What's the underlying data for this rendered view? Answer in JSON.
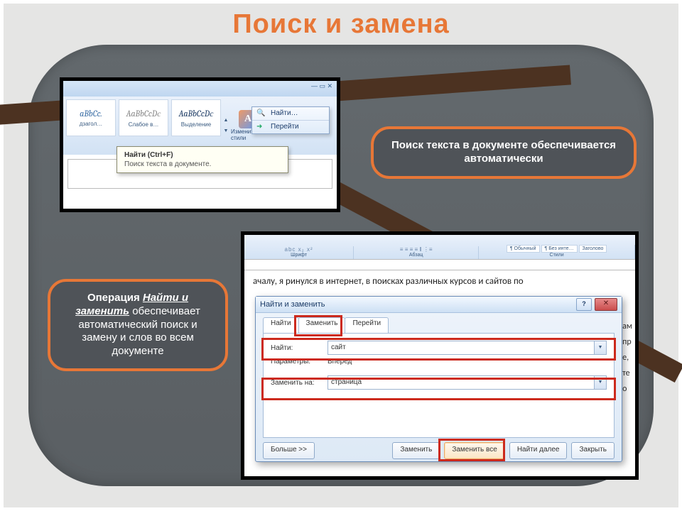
{
  "title": "Поиск и замена",
  "shot1": {
    "win_controls": "— ▭ ✕",
    "styles": [
      {
        "samp": "aBbCc.",
        "cap": "дзагол…"
      },
      {
        "samp": "AaBbCcDс",
        "cap": "Слабое в…"
      },
      {
        "samp": "AaBbCcDс",
        "cap": "Выделение"
      }
    ],
    "changeStyles": "Изменить стили",
    "menu": {
      "find": "Найти…",
      "goto": "Перейти"
    },
    "tooltip": {
      "title": "Найти (Ctrl+F)",
      "body": "Поиск текста в документе."
    }
  },
  "shot2": {
    "groups": {
      "font": "Шрифт",
      "para": "Абзац",
      "styles": "Стили"
    },
    "styleNames": {
      "s1": "¶ Обычный",
      "s2": "¶ Без инте…",
      "s3": "Заголово"
    },
    "fontbits": "abc x₂ x²",
    "bodytext": "ачалу, я ринулся в интернет, в поисках различных курсов и сайтов по",
    "sidetext": {
      "a": "ам",
      "b": "пр",
      "c": "е,",
      "d": "те",
      "e": "о"
    },
    "dlg": {
      "title": "Найти и заменить",
      "tabs": {
        "find": "Найти",
        "replace": "Заменить",
        "goto": "Перейти"
      },
      "findLabel": "Найти:",
      "findValue": "сайт",
      "paramsLabel": "Параметры:",
      "paramsValue": "Вперед",
      "replaceLabel": "Заменить на:",
      "replaceValue": "страница",
      "buttons": {
        "more": "Больше >>",
        "replace": "Заменить",
        "replaceAll": "Заменить все",
        "findNext": "Найти далее",
        "close": "Закрыть"
      },
      "q": "?",
      "x": "✕"
    }
  },
  "callouts": {
    "right": "Поиск текста в документе обеспечивается автоматически",
    "left_pre": "Операция ",
    "left_em": "Найти и заменить",
    "left_rest": " обеспечивает автоматический поиск и замену и слов во всем документе"
  }
}
